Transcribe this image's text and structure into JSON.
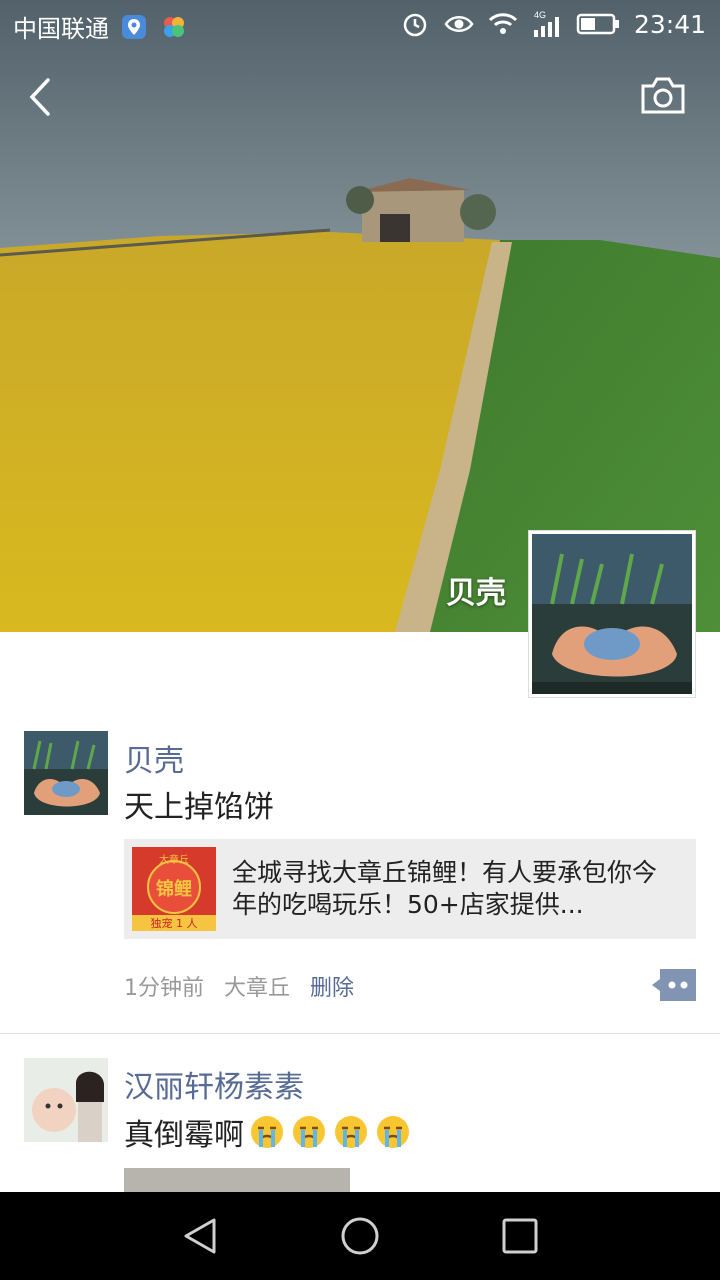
{
  "status_bar": {
    "carrier": "中国联通",
    "network": "4G",
    "time": "23:41"
  },
  "header": {
    "back_icon": "chevron-left-icon",
    "camera_icon": "camera-icon"
  },
  "profile": {
    "name": "贝壳"
  },
  "posts": [
    {
      "user": "贝壳",
      "text": "天上掉馅饼",
      "link": {
        "title": "全城寻找大章丘锦鲤！有人要承包你今年的吃喝玩乐！50+店家提供...",
        "thumb_top": "大章丘",
        "thumb_main": "锦鲤",
        "thumb_bottom": "独宠 1 人"
      },
      "time": "1分钟前",
      "location": "大章丘",
      "delete_label": "删除"
    },
    {
      "user": "汉丽轩杨素素",
      "text": "真倒霉啊",
      "emojis": [
        "crying-face-icon",
        "crying-face-icon",
        "crying-face-icon",
        "crying-face-icon"
      ]
    }
  ],
  "nav": {
    "back": "back-triangle-icon",
    "home": "home-circle-icon",
    "recents": "recents-square-icon"
  }
}
